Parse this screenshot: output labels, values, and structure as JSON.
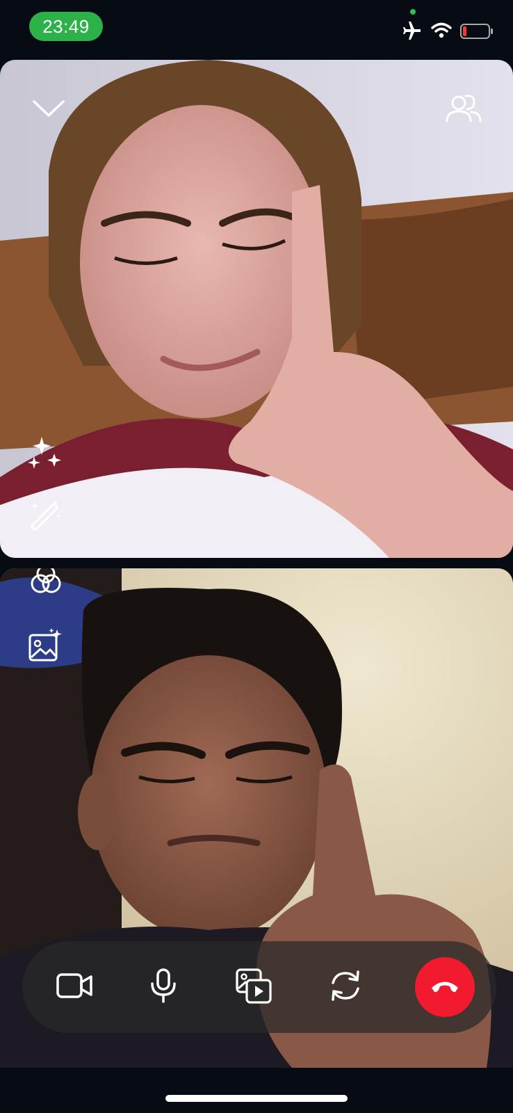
{
  "status_bar": {
    "time": "23:49",
    "icons": [
      "airplane-mode-icon",
      "wifi-icon",
      "battery-low-icon"
    ],
    "privacy_indicator_color": "#2fc24f",
    "time_pill_color": "#2db24a"
  },
  "call": {
    "top_tile": {
      "icons": [
        "collapse-chevron-icon",
        "participants-icon",
        "sparkles-effects-icon",
        "magic-wand-icon",
        "filters-icon",
        "background-image-icon"
      ]
    },
    "bottom_tile": {}
  },
  "controls": {
    "buttons": [
      "camera-icon",
      "microphone-icon",
      "share-media-icon",
      "flip-camera-icon",
      "end-call-icon"
    ],
    "end_call_color": "#f21a2f"
  }
}
